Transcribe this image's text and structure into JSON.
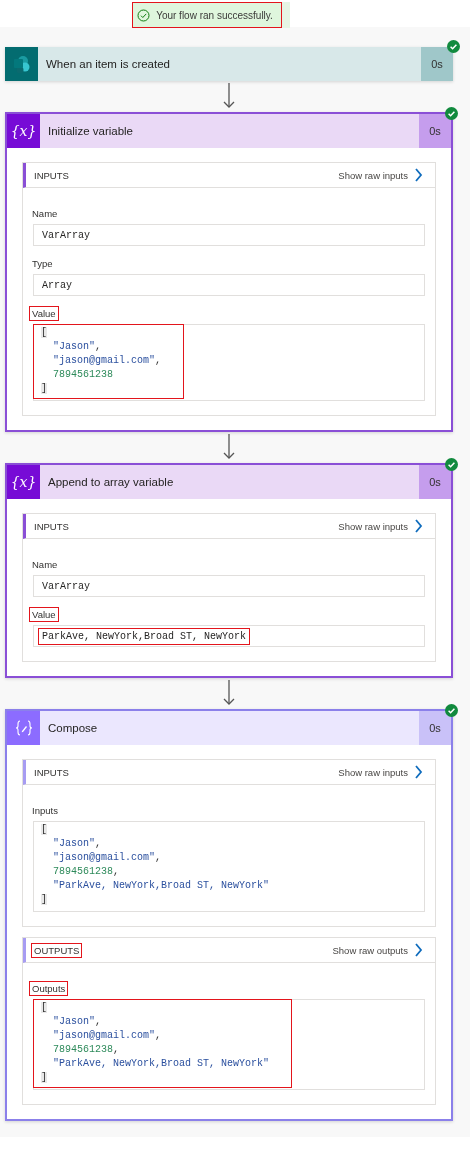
{
  "banner": {
    "text": "Your flow ran successfully.",
    "highlighted": true
  },
  "steps": [
    {
      "kind": "trigger",
      "title": "When an item is created",
      "duration": "0s",
      "succeeded": true
    },
    {
      "kind": "variable",
      "icon_text": "{x}",
      "title": "Initialize variable",
      "duration": "0s",
      "succeeded": true,
      "sections": [
        {
          "heading": "INPUTS",
          "heading_highlighted": false,
          "raw_link": "Show raw inputs",
          "fields": [
            {
              "label": "Name",
              "label_highlighted": false,
              "kind": "text",
              "value": "VarArray",
              "value_highlighted": false
            },
            {
              "label": "Type",
              "label_highlighted": false,
              "kind": "text",
              "value": "Array",
              "value_highlighted": false
            },
            {
              "label": "Value",
              "label_highlighted": true,
              "kind": "code",
              "value_highlighted": true,
              "lines": [
                {
                  "kind": "bracket",
                  "text": "["
                },
                {
                  "kind": "string",
                  "text": "\"Jason\"",
                  "after": ","
                },
                {
                  "kind": "string",
                  "text": "\"jason@gmail.com\"",
                  "after": ","
                },
                {
                  "kind": "number",
                  "text": "7894561238"
                },
                {
                  "kind": "bracket",
                  "text": "]"
                }
              ]
            }
          ]
        }
      ]
    },
    {
      "kind": "variable",
      "icon_text": "{x}",
      "title": "Append to array variable",
      "duration": "0s",
      "succeeded": true,
      "sections": [
        {
          "heading": "INPUTS",
          "heading_highlighted": false,
          "raw_link": "Show raw inputs",
          "fields": [
            {
              "label": "Name",
              "label_highlighted": false,
              "kind": "text",
              "value": "VarArray",
              "value_highlighted": false
            },
            {
              "label": "Value",
              "label_highlighted": true,
              "kind": "text",
              "value": "ParkAve, NewYork,Broad ST, NewYork",
              "value_highlighted": true
            }
          ]
        }
      ]
    },
    {
      "kind": "compose",
      "title": "Compose",
      "duration": "0s",
      "succeeded": true,
      "sections": [
        {
          "heading": "INPUTS",
          "heading_highlighted": false,
          "raw_link": "Show raw inputs",
          "fields": [
            {
              "label": "Inputs",
              "label_highlighted": false,
              "kind": "code",
              "value_highlighted": false,
              "lines": [
                {
                  "kind": "bracket",
                  "text": "["
                },
                {
                  "kind": "string",
                  "text": "\"Jason\"",
                  "after": ","
                },
                {
                  "kind": "string",
                  "text": "\"jason@gmail.com\"",
                  "after": ","
                },
                {
                  "kind": "number",
                  "text": "7894561238",
                  "after": ","
                },
                {
                  "kind": "string",
                  "text": "\"ParkAve, NewYork,Broad ST, NewYork\""
                },
                {
                  "kind": "bracket",
                  "text": "]"
                }
              ]
            }
          ]
        },
        {
          "heading": "OUTPUTS",
          "heading_highlighted": true,
          "raw_link": "Show raw outputs",
          "fields": [
            {
              "label": "Outputs",
              "label_highlighted": true,
              "kind": "code",
              "value_highlighted": true,
              "lines": [
                {
                  "kind": "bracket",
                  "text": "["
                },
                {
                  "kind": "string",
                  "text": "\"Jason\"",
                  "after": ","
                },
                {
                  "kind": "string",
                  "text": "\"jason@gmail.com\"",
                  "after": ","
                },
                {
                  "kind": "number",
                  "text": "7894561238",
                  "after": ","
                },
                {
                  "kind": "string",
                  "text": "\"ParkAve, NewYork,Broad ST, NewYork\""
                },
                {
                  "kind": "bracket",
                  "text": "]"
                }
              ]
            }
          ]
        }
      ]
    }
  ]
}
